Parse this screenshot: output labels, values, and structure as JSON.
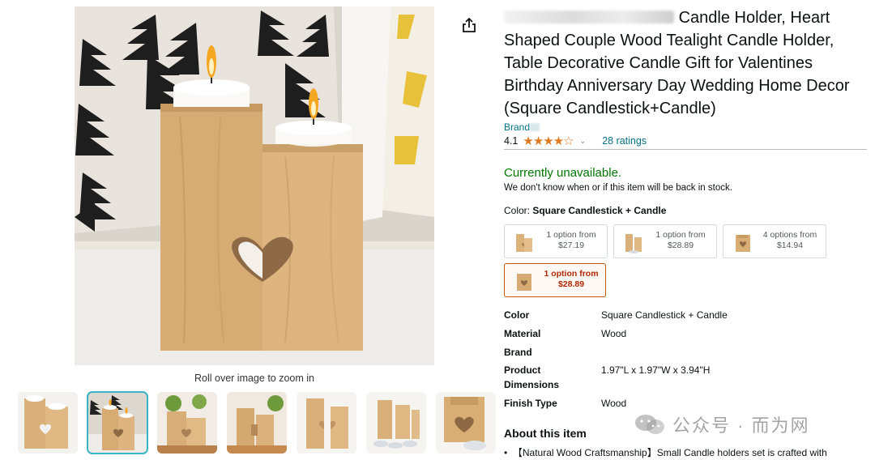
{
  "gallery": {
    "zoom_hint": "Roll over image to zoom in",
    "thumbnails": [
      "thumb-1",
      "thumb-2",
      "thumb-3",
      "thumb-4",
      "thumb-5",
      "thumb-6",
      "thumb-7"
    ],
    "selected_index": 1
  },
  "product": {
    "title_line1_visible": "Candle Holder, Heart",
    "title_rest": "Shaped Couple Wood Tealight Candle Holder, Table Decorative Candle Gift for Valentines Birthday Anniversary Day Wedding Home Decor (Square Candlestick+Candle)",
    "brand_prefix": "Brand",
    "rating_value": "4.1",
    "stars_text": "★★★★☆",
    "ratings_count": "28 ratings",
    "availability": "Currently unavailable.",
    "availability_note": "We don't know when or if this item will be back in stock.",
    "color_label": "Color: ",
    "color_value": "Square Candlestick + Candle"
  },
  "options": [
    {
      "line1": "1 option from",
      "line2": "$27.19"
    },
    {
      "line1": "1 option from",
      "line2": "$28.89"
    },
    {
      "line1": "4 options from",
      "line2": "$14.94"
    },
    {
      "line1": "1 option from",
      "line2": "$28.89"
    }
  ],
  "specs": [
    {
      "key": "Color",
      "value": "Square Candlestick + Candle"
    },
    {
      "key": "Material",
      "value": "Wood"
    },
    {
      "key": "Brand",
      "value": ""
    },
    {
      "key": "Product Dimensions",
      "value": "1.97\"L x 1.97\"W x 3.94\"H"
    },
    {
      "key": "Finish Type",
      "value": "Wood"
    }
  ],
  "about": {
    "heading": "About this item",
    "bullet1": "【Natural Wood Craftsmanship】Small Candle holders set is crafted with"
  },
  "watermark": {
    "text": "公众号 · 而为网"
  },
  "colors": {
    "link": "#007185",
    "in_stock_green": "#007600",
    "star": "#de7921",
    "selected_border": "#c45500",
    "selected_thumb": "#39b4c4"
  }
}
